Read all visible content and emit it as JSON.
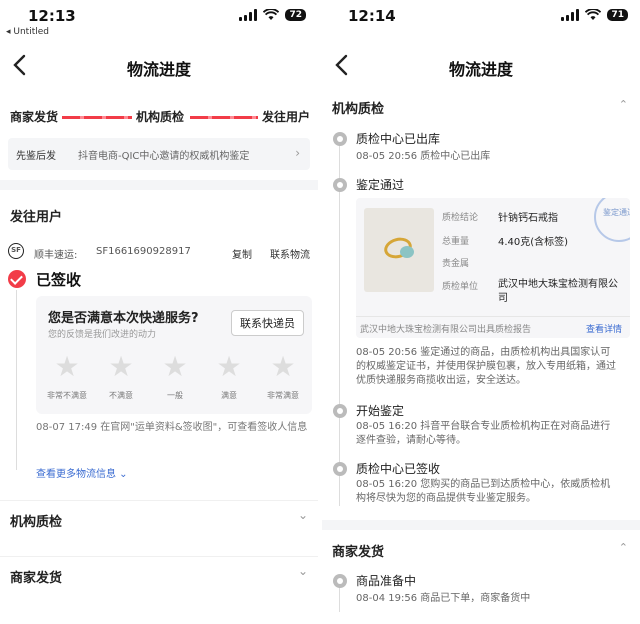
{
  "left": {
    "status": {
      "time": "12:13",
      "back_app": "◂ Untitled",
      "battery": "72"
    },
    "nav_title": "物流进度",
    "progress": [
      "商家发货",
      "机构质检",
      "发往用户"
    ],
    "note": {
      "a": "先鉴后发",
      "b": "抖音电商-QIC中心邀请的权威机构鉴定",
      "chev": "›"
    },
    "section_title": "发往用户",
    "shipment": {
      "carrier": "顺丰速运:",
      "waybill": "SF1661690928917",
      "copy": "复制",
      "contact": "联系物流"
    },
    "signed_label": "已签收",
    "survey": {
      "question": "您是否满意本次快递服务?",
      "sub": "您的反馈是我们改进的动力",
      "button": "联系快递员",
      "stars": [
        "非常不满意",
        "不满意",
        "一般",
        "满意",
        "非常满意"
      ]
    },
    "signed_info": "08-07 17:49  在官网\"运单资料&签收图\"，可查看签收人信息",
    "more_link": "查看更多物流信息 ⌄",
    "collapsed": [
      {
        "title": "机构质检",
        "chev": "⌄"
      },
      {
        "title": "商家发货",
        "chev": "⌄"
      }
    ]
  },
  "right": {
    "status": {
      "time": "12:14",
      "battery": "71"
    },
    "nav_title": "物流进度",
    "section1": {
      "title": "机构质检",
      "chev": "⌃"
    },
    "events": [
      {
        "title": "质检中心已出库",
        "text": "08-05 20:56  质检中心已出库"
      },
      {
        "title": "鉴定通过",
        "text": ""
      },
      {
        "title": "",
        "text": "08-05 20:56  鉴定通过的商品，由质检机构出具国家认可的权威鉴定证书，并使用保护膜包裹，放入专用纸箱，通过优质快递服务商揽收出运，安全送达。"
      },
      {
        "title": "开始鉴定",
        "text": "08-05 16:20  抖音平台联合专业质检机构正在对商品进行逐件查验，请耐心等待。"
      },
      {
        "title": "质检中心已签收",
        "text": "08-05 16:20  您购买的商品已到达质检中心，依威质检机构将尽快为您的商品提供专业鉴定服务。"
      }
    ],
    "cert": {
      "rows": [
        {
          "k": "质检结论",
          "v": "针钠钙石戒指"
        },
        {
          "k": "总重量",
          "v": "4.40克(含标签)"
        },
        {
          "k": "贵金属",
          "v": ""
        },
        {
          "k": "质检单位",
          "v": "武汉中地大珠宝检测有限公司"
        }
      ],
      "stamp": "鉴定通过",
      "foot": "武汉中地大珠宝检测有限公司出具质检报告",
      "detail": "查看详情"
    },
    "section2": {
      "title": "商家发货",
      "chev": "⌃"
    },
    "events2": [
      {
        "title": "商品准备中",
        "text": "08-04 19:56  商品已下单，商家备货中"
      }
    ]
  }
}
